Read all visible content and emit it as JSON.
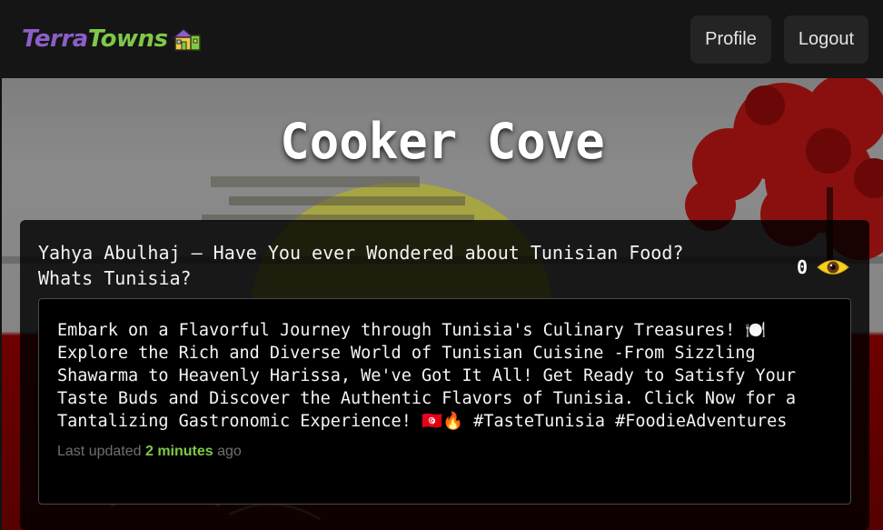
{
  "navbar": {
    "logo": {
      "terra": "Terra",
      "towns": "Towns",
      "icon": "house-icon"
    },
    "profile_label": "Profile",
    "logout_label": "Logout"
  },
  "hero": {
    "title": "Cooker Cove"
  },
  "post": {
    "title": "Yahya Abulhaj — Have You ever Wondered about Tunisian Food? Whats Tunisia?",
    "view_count": "0",
    "view_icon": "eye-icon",
    "content": "Embark on a Flavorful Journey through Tunisia's Culinary Treasures! 🍽️ Explore the Rich and Diverse World of Tunisian Cuisine -From Sizzling Shawarma to Heavenly Harissa, We've Got It All! Get Ready to Satisfy Your Taste Buds and Discover the Authentic Flavors of Tunisia. Click Now for a Tantalizing Gastronomic Experience! 🇹🇳🔥 #TasteTunisia #FoodieAdventures",
    "last_updated_prefix": "Last updated",
    "last_updated_value": "2 minutes",
    "last_updated_suffix": "ago"
  },
  "colors": {
    "brand_purple": "#8b5fc8",
    "brand_green": "#7ec84a",
    "background": "#151515",
    "eye_yellow": "#f5d020"
  }
}
